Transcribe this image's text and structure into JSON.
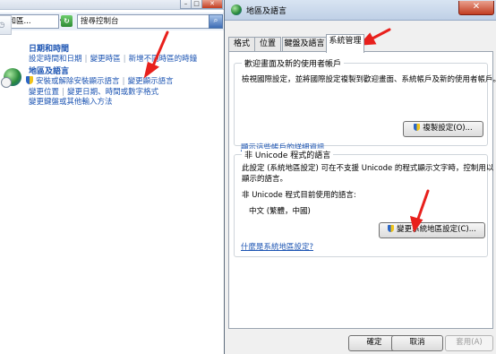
{
  "control_panel": {
    "address": "查和區...",
    "search_placeholder": "搜尋控制台",
    "categories": [
      {
        "title": "日期和時間",
        "links": [
          "設定時間和日期",
          "變更時區",
          "新增不同時區的時鐘"
        ]
      },
      {
        "title": "地區及語言",
        "links": [
          "安裝或解除安裝顯示語言",
          "變更顯示語言",
          "變更位置",
          "變更日期、時間或數字格式",
          "變更鍵盤或其他輸入方法"
        ]
      }
    ]
  },
  "dialog": {
    "title": "地區及語言",
    "tabs": [
      "格式",
      "位置",
      "鍵盤及語言",
      "系統管理"
    ],
    "active_tab": "系統管理",
    "welcome_group": {
      "title": "歡迎畫面及新的使用者帳戶",
      "description": "檢視國際設定，並將國際設定複製到歡迎畫面、系統帳戶及新的使用者帳戶。",
      "copy_button": "複製設定(O)...",
      "link": "顯示這些帳戶的詳細資訊"
    },
    "unicode_group": {
      "title": "非 Unicode 程式的語言",
      "description_line1": "此設定 (系統地區設定) 可在不支援 Unicode 的程式顯示文字時，控制用以",
      "description_line2": "顯示的語言。",
      "current_label": "非 Unicode 程式目前使用的語言:",
      "current_value": "中文 (繁體，中國)",
      "change_button": "變更系統地區設定(C)...",
      "link": "什麼是系統地區設定?"
    },
    "buttons": {
      "ok": "確定",
      "cancel": "取消",
      "apply": "套用(A)"
    }
  },
  "colors": {
    "link": "#1d55b3",
    "annotation_arrow": "#e8201c",
    "window_frame": "#bfd0e6"
  }
}
